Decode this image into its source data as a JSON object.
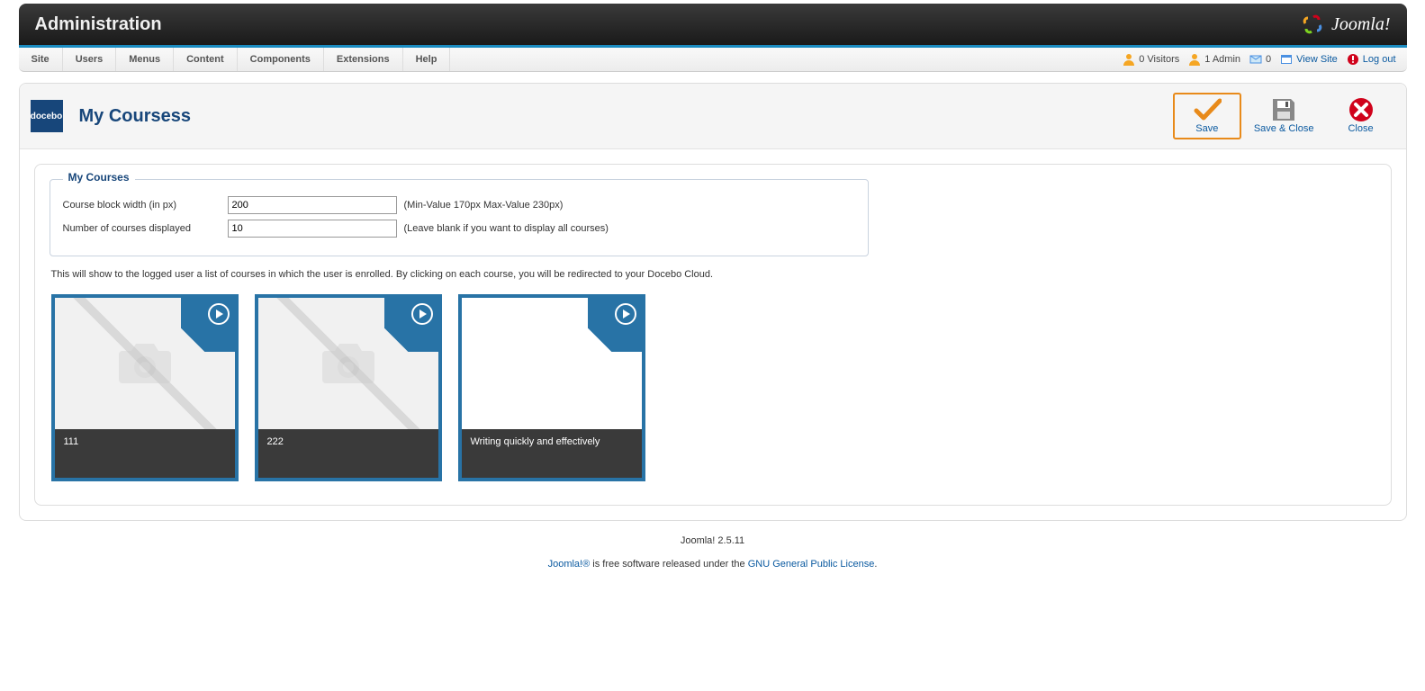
{
  "topbar": {
    "title": "Administration",
    "brand": "Joomla!"
  },
  "menu": {
    "items": [
      "Site",
      "Users",
      "Menus",
      "Content",
      "Components",
      "Extensions",
      "Help"
    ],
    "status": {
      "visitors_label": "0 Visitors",
      "admin_label": "1 Admin",
      "mail_count": "0",
      "view_site": "View Site",
      "logout": "Log out"
    }
  },
  "header": {
    "logo_text": "docebo",
    "title": "My Coursess",
    "toolbar": {
      "save": "Save",
      "save_close": "Save & Close",
      "close": "Close"
    }
  },
  "form": {
    "legend": "My Courses",
    "width_label": "Course block width (in px)",
    "width_value": "200",
    "width_hint": "(Min-Value 170px Max-Value 230px)",
    "count_label": "Number of courses displayed",
    "count_value": "10",
    "count_hint": "(Leave blank if you want to display all courses)"
  },
  "description": "This will show to the logged user a list of courses in which the user is enrolled. By clicking on each course, you will be redirected to your Docebo Cloud.",
  "courses": [
    {
      "title": "111",
      "has_thumb": true
    },
    {
      "title": "222",
      "has_thumb": true
    },
    {
      "title": "Writing quickly and effectively",
      "has_thumb": false
    }
  ],
  "footer": {
    "version": "Joomla! 2.5.11",
    "text_a": "Joomla!®",
    "text_b": " is free software released under the ",
    "license": "GNU General Public License",
    "text_c": "."
  }
}
